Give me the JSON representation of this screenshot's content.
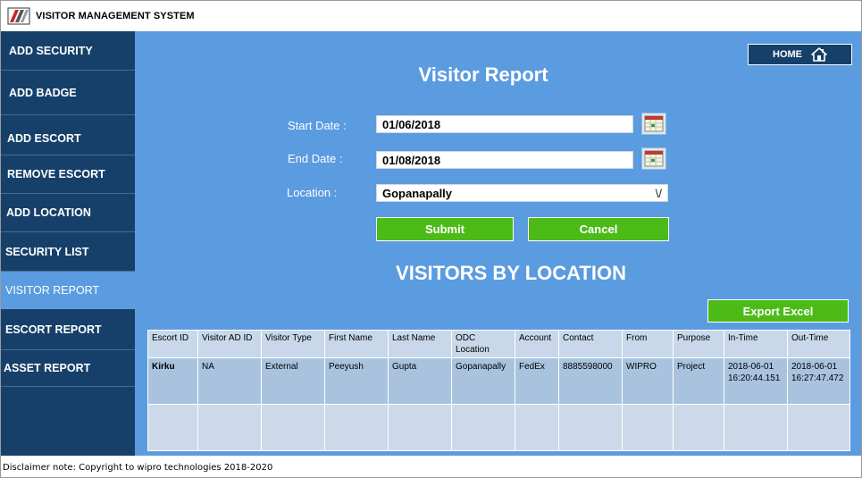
{
  "app": {
    "title": "VISITOR MANAGEMENT SYSTEM"
  },
  "sidebar": {
    "items": [
      {
        "label": "ADD SECURITY"
      },
      {
        "label": "ADD BADGE"
      },
      {
        "label": "ADD ESCORT"
      },
      {
        "label": "REMOVE ESCORT"
      },
      {
        "label": "ADD LOCATION"
      },
      {
        "label": "SECURITY LIST"
      },
      {
        "label": "VISITOR REPORT"
      },
      {
        "label": "ESCORT REPORT"
      },
      {
        "label": "ASSET REPORT"
      }
    ],
    "active_item": "VISITOR REPORT"
  },
  "header": {
    "home_label": "HOME"
  },
  "page": {
    "title": "Visitor Report"
  },
  "form": {
    "start_date_label": "Start Date :",
    "start_date_value": "01/06/2018",
    "end_date_label": "End Date :",
    "end_date_value": "01/08/2018",
    "location_label": "Location :",
    "location_value": "Gopanapally",
    "location_arrow": "\\/",
    "submit_label": "Submit",
    "cancel_label": "Cancel"
  },
  "report": {
    "title": "VISITORS BY LOCATION",
    "export_label": "Export Excel",
    "columns": [
      "Escort ID",
      "Visitor AD ID",
      "Visitor Type",
      "First Name",
      "Last Name",
      "ODC Location",
      "Account",
      "Contact",
      "From",
      "Purpose",
      "In-Time",
      "Out-Time"
    ],
    "rows": [
      [
        "Kirku",
        "NA",
        "External",
        "Peeyush",
        "Gupta",
        "Gopanapally",
        "FedEx",
        "8885598000",
        "WIPRO",
        "Project",
        "2018-06-01 16:20:44.151",
        "2018-06-01 16:27:47.472"
      ]
    ]
  },
  "footer": {
    "text": "Disclaimer note: Copyright to wipro technologies 2018-2020"
  },
  "colors": {
    "sidebar_bg": "#16406a",
    "main_bg": "#5b9be0",
    "accent_green": "#4cbb17",
    "table_header": "#c8d8ea",
    "table_row": "#a9c3df"
  }
}
